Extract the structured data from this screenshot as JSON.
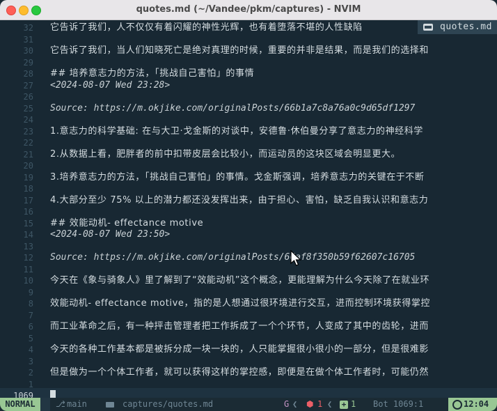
{
  "window": {
    "title": "quotes.md (~/Vandee/pkm/captures) - NVIM"
  },
  "tab": {
    "label": "quotes.md",
    "icon": "markdown-icon"
  },
  "lines": [
    {
      "num": "32",
      "text": "它告诉了我们，人不仅仅有着闪耀的神性光辉，也有着堕落不堪的人性缺陷",
      "kind": "text"
    },
    {
      "num": "31",
      "text": "",
      "kind": "blank"
    },
    {
      "num": "30",
      "text": "它告诉了我们，当人们知晓死亡是绝对真理的时候，重要的并非是结果，而是我们的选择和",
      "kind": "text"
    },
    {
      "num": "29",
      "text": "",
      "kind": "blank"
    },
    {
      "num": "28",
      "text": "## 培养意志力的方法，「挑战自己害怕」的事情",
      "kind": "heading"
    },
    {
      "num": "27",
      "text": "<2024-08-07 Wed 23:28>",
      "kind": "date"
    },
    {
      "num": "26",
      "text": "",
      "kind": "blank"
    },
    {
      "num": "25",
      "text": "Source: https://m.okjike.com/originalPosts/66b1a7c8a76a0c9d65df1297",
      "kind": "source"
    },
    {
      "num": "24",
      "text": "",
      "kind": "blank"
    },
    {
      "num": "23",
      "text": "1.意志力的科学基础: 在与大卫·戈金斯的对谈中，安德鲁·休伯曼分享了意志力的神经科学",
      "kind": "text"
    },
    {
      "num": "22",
      "text": "",
      "kind": "blank"
    },
    {
      "num": "21",
      "text": "2.从数据上看，肥胖者的前中扣带皮层会比较小，而运动员的这块区域会明显更大。",
      "kind": "text"
    },
    {
      "num": "20",
      "text": "",
      "kind": "blank"
    },
    {
      "num": "19",
      "text": "3.培养意志力的方法，「挑战自己害怕」的事情。戈金斯强调，培养意志力的关键在于不断",
      "kind": "text"
    },
    {
      "num": "18",
      "text": "",
      "kind": "blank"
    },
    {
      "num": "17",
      "text": "4.大部分至少 75% 以上的潜力都还没发挥出来，由于担心、害怕，缺乏自我认识和意志力",
      "kind": "text"
    },
    {
      "num": "16",
      "text": "",
      "kind": "blank"
    },
    {
      "num": "15",
      "text": "## 效能动机- effectance motive",
      "kind": "heading"
    },
    {
      "num": "14",
      "text": "<2024-08-07 Wed 23:50>",
      "kind": "date"
    },
    {
      "num": "13",
      "text": "",
      "kind": "blank"
    },
    {
      "num": "12",
      "text": "Source: https://m.okjike.com/originalPosts/66af8f350b59f62607c16705",
      "kind": "source"
    },
    {
      "num": "11",
      "text": "",
      "kind": "blank"
    },
    {
      "num": "10",
      "text": "今天在《象与骑象人》里了解到了“效能动机”这个概念，更能理解为什么今天除了在就业环",
      "kind": "text"
    },
    {
      "num": "9",
      "text": "",
      "kind": "blank"
    },
    {
      "num": "8",
      "text": "效能动机- effectance motive，指的是人想通过很环境进行交互，进而控制环境获得掌控",
      "kind": "text"
    },
    {
      "num": "7",
      "text": "",
      "kind": "blank"
    },
    {
      "num": "6",
      "text": "而工业革命之后，有一种抨击管理者把工作拆成了一个个环节，人变成了其中的齿轮，进而",
      "kind": "text"
    },
    {
      "num": "5",
      "text": "",
      "kind": "blank"
    },
    {
      "num": "4",
      "text": "今天的各种工作基本都是被拆分成一块一块的，人只能掌握很小很小的一部分，但是很难影",
      "kind": "text"
    },
    {
      "num": "3",
      "text": "",
      "kind": "blank"
    },
    {
      "num": "2",
      "text": "但是做为一个个体工作者，就可以获得这样的掌控感，即便是在做个体工作者时，可能仍然",
      "kind": "text"
    },
    {
      "num": "1",
      "text": "",
      "kind": "blank"
    }
  ],
  "current_line": {
    "num": "1069",
    "text": ""
  },
  "status": {
    "mode": "NORMAL",
    "branch_icon": "git-branch-icon",
    "branch": "main",
    "file_icon": "file-icon",
    "filepath": "captures/quotes.md",
    "git_letter": "G",
    "error_count": "1",
    "add_count": "1",
    "position": "Bot 1069:1",
    "time": "12:04",
    "colors": {
      "mode_bg": "#99c794",
      "error": "#ec5f67",
      "git": "#c594c5",
      "bg": "#182833"
    }
  }
}
